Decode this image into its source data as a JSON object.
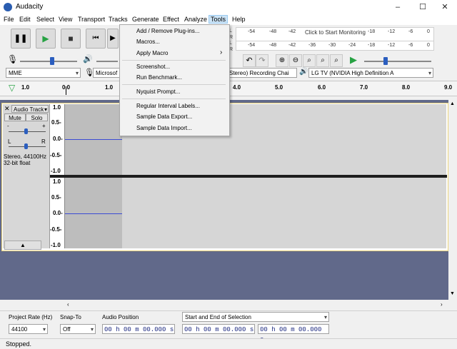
{
  "window": {
    "title": "Audacity",
    "minimize": "–",
    "maximize": "☐",
    "close": "✕"
  },
  "menubar": [
    "File",
    "Edit",
    "Select",
    "View",
    "Transport",
    "Tracks",
    "Generate",
    "Effect",
    "Analyze",
    "Tools",
    "Help"
  ],
  "tools_menu": {
    "items": [
      "Add / Remove Plug-ins...",
      "Macros...",
      "Apply Macro",
      "Screenshot...",
      "Run Benchmark...",
      "Nyquist Prompt...",
      "Regular Interval Labels...",
      "Sample Data Export...",
      "Sample Data Import..."
    ],
    "submenu_arrow": "›"
  },
  "meters": {
    "record_ticks": [
      "-54",
      "-48",
      "-42",
      "Click to Start Monitoring",
      "-18",
      "-12",
      "-6",
      "0"
    ],
    "play_ticks": [
      "-54",
      "-48",
      "-42",
      "-36",
      "-30",
      "-24",
      "-18",
      "-12",
      "-6",
      "0"
    ],
    "record_channels": [
      "L",
      "R"
    ],
    "play_channels": [
      "L",
      "R"
    ]
  },
  "device": {
    "host": "MME",
    "recording_partial": "Microsof",
    "recording_device_partial": "Stereo) Recording Chai",
    "playback_device": "LG TV (NVIDIA High Definition A"
  },
  "ruler": [
    "1.0",
    "0.0",
    "1.0",
    "4.0",
    "5.0",
    "6.0",
    "7.0",
    "8.0",
    "9.0"
  ],
  "track": {
    "name": "Audio Track",
    "mute": "Mute",
    "solo": "Solo",
    "gain_minus": "-",
    "gain_plus": "+",
    "pan_left": "L",
    "pan_right": "R",
    "info_line1": "Stereo, 44100Hz",
    "info_line2": "32-bit float",
    "scale": [
      "1.0",
      "0.5-",
      "0.0-",
      "-0.5-",
      "-1.0"
    ]
  },
  "selection_toolbar": {
    "project_rate_label": "Project Rate (Hz)",
    "project_rate_value": "44100",
    "snap_to_label": "Snap-To",
    "snap_to_value": "Off",
    "audio_position_label": "Audio Position",
    "selection_label": "Start and End of Selection",
    "time_value": "00 h 00 m 00.000 s"
  },
  "status": "Stopped.",
  "colors": {
    "accent_menu": "#cce4f7",
    "track_bg": "#61698a",
    "wave_line": "#3b4bd4",
    "track_border": "#e8d27a"
  }
}
